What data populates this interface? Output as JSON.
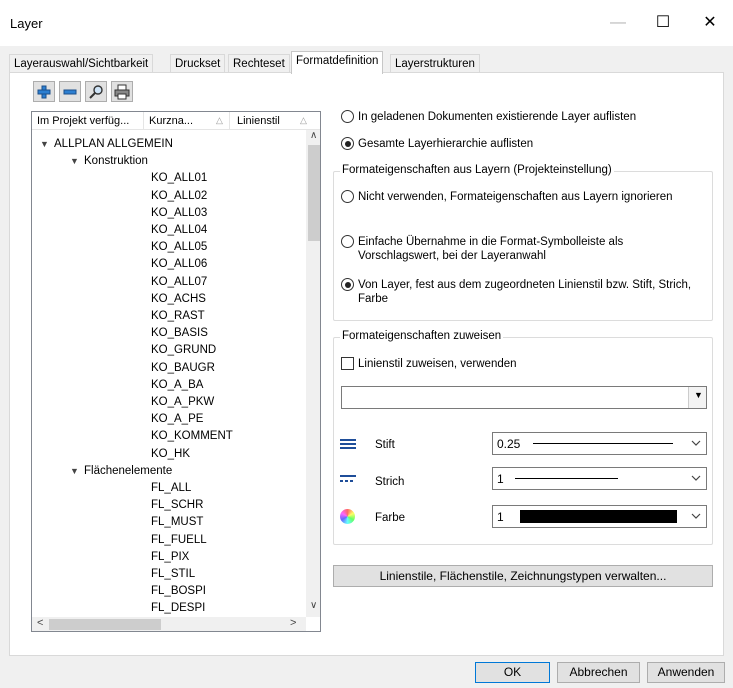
{
  "window": {
    "title": "Layer"
  },
  "tabs": [
    {
      "label": "Layerauswahl/Sichtbarkeit"
    },
    {
      "label": "Druckset"
    },
    {
      "label": "Rechteset"
    },
    {
      "label": "Formatdefinition"
    },
    {
      "label": "Layerstrukturen"
    }
  ],
  "tree": {
    "columns": [
      "Im Projekt verfüg...",
      "Kurzna...",
      "Linienstil"
    ],
    "root": "ALLPLAN ALLGEMEIN",
    "groups": [
      {
        "label": "Konstruktion",
        "items": [
          "KO_ALL01",
          "KO_ALL02",
          "KO_ALL03",
          "KO_ALL04",
          "KO_ALL05",
          "KO_ALL06",
          "KO_ALL07",
          "KO_ACHS",
          "KO_RAST",
          "KO_BASIS",
          "KO_GRUND",
          "KO_BAUGR",
          "KO_A_BA",
          "KO_A_PKW",
          "KO_A_PE",
          "KO_KOMMENT",
          "KO_HK"
        ]
      },
      {
        "label": "Flächenelemente",
        "items": [
          "FL_ALL",
          "FL_SCHR",
          "FL_MUST",
          "FL_FUELL",
          "FL_PIX",
          "FL_STIL",
          "FL_BOSPI",
          "FL_DESPI"
        ]
      }
    ]
  },
  "options": {
    "list_existing": "In geladenen Dokumenten existierende Layer auflisten",
    "list_all": "Gesamte Layerhierarchie auflisten",
    "list_selected": "all"
  },
  "format_props": {
    "title": "Formateigenschaften aus Layern (Projekteinstellung)",
    "opt1": "Nicht verwenden, Formateigenschaften aus Layern ignorieren",
    "opt2_line1": "Einfache Übernahme in die Format-Symbolleiste als",
    "opt2_line2": "Vorschlagswert, bei der Layeranwahl",
    "opt3_line1": "Von Layer, fest aus dem zugeordneten Linienstil bzw. Stift, Strich,",
    "opt3_line2": "Farbe",
    "selected": "opt3"
  },
  "assign": {
    "title": "Formateigenschaften zuweisen",
    "checkbox_label": "Linienstil zuweisen, verwenden",
    "checkbox_checked": false,
    "linestyle_value": "",
    "pen_label": "Stift",
    "pen_value": "0.25",
    "stroke_label": "Strich",
    "stroke_value": "1",
    "color_label": "Farbe",
    "color_value": "1",
    "color_swatch": "#000000"
  },
  "manage_button": "Linienstile, Flächenstile, Zeichnungstypen verwalten...",
  "footer": {
    "ok": "OK",
    "cancel": "Abbrechen",
    "apply": "Anwenden"
  },
  "colors": {
    "accent": "#0078d7",
    "selected_tab_border": "#c7c7c7"
  }
}
